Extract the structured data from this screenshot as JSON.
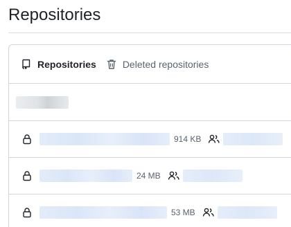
{
  "header": {
    "title": "Repositories"
  },
  "tabs": [
    {
      "label": "Repositories",
      "icon": "repo-icon",
      "active": true
    },
    {
      "label": "Deleted repositories",
      "icon": "trash-icon",
      "active": false
    }
  ],
  "repos": [
    {
      "size": "914 KB"
    },
    {
      "size": "24 MB"
    },
    {
      "size": "53 MB"
    }
  ],
  "colors": {
    "border": "#d0d7de",
    "text": "#1f2328",
    "muted": "#59636e",
    "link_blur": "#dae6f8"
  }
}
